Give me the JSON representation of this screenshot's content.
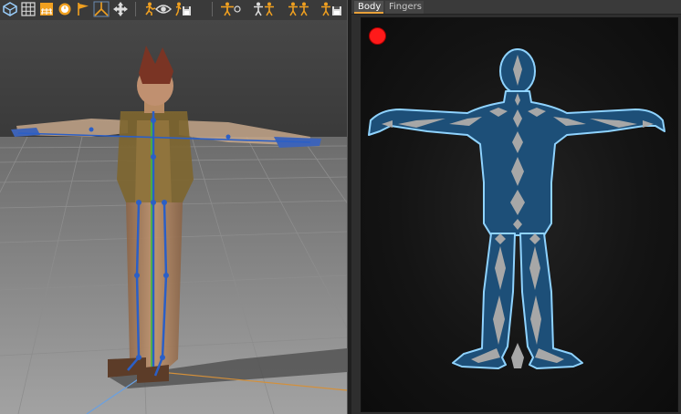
{
  "toolbar": {
    "buttons": [
      {
        "name": "cube-view-icon",
        "color": "#9bd0ff"
      },
      {
        "name": "grid-icon",
        "color": "#dddddd"
      },
      {
        "name": "floor-grid-icon",
        "color": "#dddddd"
      },
      {
        "name": "clock-icon",
        "color": "#f0a020"
      },
      {
        "name": "flag-icon",
        "color": "#f0a020"
      },
      {
        "name": "axes-icon",
        "color": "#f0a020"
      },
      {
        "name": "move-arrows-icon",
        "color": "#dddddd"
      },
      {
        "name": "character-run-icon",
        "color": "#f0a020"
      },
      {
        "name": "eye-icon",
        "color": "#dddddd"
      },
      {
        "name": "character-save-icon",
        "color": "#f0a020"
      },
      {
        "name": "tpose-character-icon",
        "color": "#f0a020"
      },
      {
        "name": "tpose-pair-icon",
        "color": "#f0a020"
      },
      {
        "name": "tpose-mirror-icon",
        "color": "#f0a020"
      },
      {
        "name": "tpose-save-icon",
        "color": "#f0a020"
      }
    ]
  },
  "tabs": [
    {
      "label": "Body",
      "active": true
    },
    {
      "label": "Fingers",
      "active": false
    }
  ],
  "colors": {
    "accent": "#e8a13a",
    "body_fill": "#1d4f78",
    "body_outline": "#8fd3ff",
    "bone": "#a7a7a7",
    "record": "#ff1a1a"
  },
  "status": {
    "recording_indicator": "red-dot"
  }
}
